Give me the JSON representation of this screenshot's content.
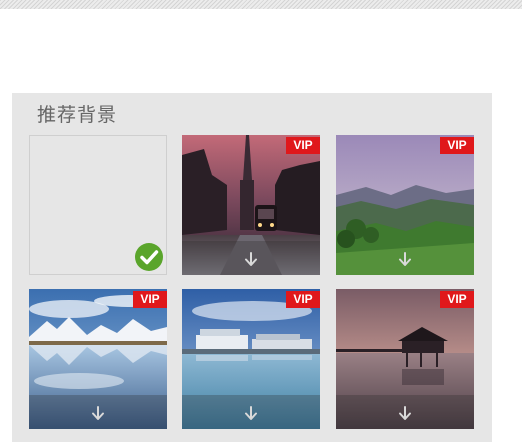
{
  "section": {
    "title": "推荐背景"
  },
  "tiles": [
    {
      "name": "blank",
      "selected": true,
      "vip": ""
    },
    {
      "name": "city-street-tram",
      "selected": false,
      "vip": "VIP"
    },
    {
      "name": "mountain-valley",
      "selected": false,
      "vip": "VIP"
    },
    {
      "name": "snowy-mountain-lake",
      "selected": false,
      "vip": "VIP"
    },
    {
      "name": "harbor-boats",
      "selected": false,
      "vip": "VIP"
    },
    {
      "name": "pier-hut-sunset",
      "selected": false,
      "vip": "VIP"
    }
  ],
  "icons": {
    "selected": "check-circle-icon",
    "download": "download-arrow-icon"
  },
  "colors": {
    "vip_badge": "#e0181b",
    "check": "#5aa52b",
    "panel_bg": "#e6e6e6"
  }
}
